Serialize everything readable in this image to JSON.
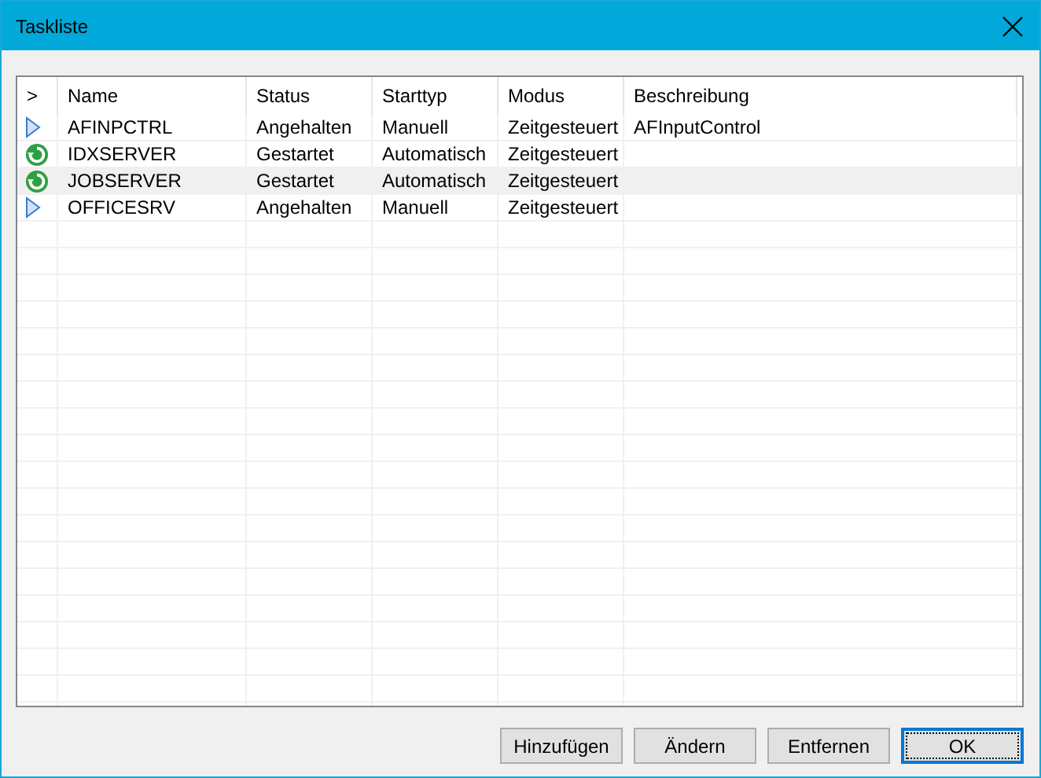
{
  "window": {
    "title": "Taskliste"
  },
  "table": {
    "columns": [
      ">",
      "Name",
      "Status",
      "Starttyp",
      "Modus",
      "Beschreibung"
    ],
    "rows": [
      {
        "kind": "stopped",
        "selected": false,
        "cells": [
          "",
          "AFINPCTRL",
          "Angehalten",
          "Manuell",
          "Zeitgesteuert",
          "AFInputControl"
        ]
      },
      {
        "kind": "running",
        "selected": false,
        "cells": [
          "",
          "IDXSERVER",
          "Gestartet",
          "Automatisch",
          "Zeitgesteuert",
          ""
        ]
      },
      {
        "kind": "running",
        "selected": true,
        "cells": [
          "",
          "JOBSERVER",
          "Gestartet",
          "Automatisch",
          "Zeitgesteuert",
          ""
        ]
      },
      {
        "kind": "stopped",
        "selected": false,
        "cells": [
          "",
          "OFFICESRV",
          "Angehalten",
          "Manuell",
          "Zeitgesteuert",
          ""
        ]
      }
    ]
  },
  "buttons": [
    {
      "label": "Hinzufügen",
      "default": false
    },
    {
      "label": "Ändern",
      "default": false
    },
    {
      "label": "Entfernen",
      "default": false
    },
    {
      "label": "OK",
      "default": true
    }
  ]
}
